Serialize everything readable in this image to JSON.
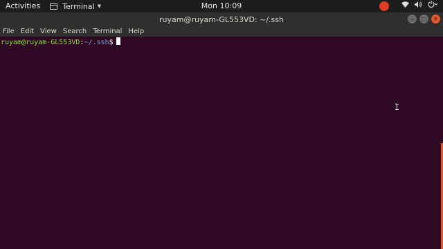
{
  "topbar": {
    "activities_label": "Activities",
    "app_name": "Terminal",
    "clock": "Mon 10:09",
    "icons": [
      "record-icon",
      "wifi-icon",
      "volume-icon",
      "power-icon"
    ]
  },
  "window": {
    "title": "ruyam@ruyam-GL553VD: ~/.ssh",
    "controls": [
      "minimize",
      "maximize",
      "close"
    ]
  },
  "menubar": {
    "items": [
      "File",
      "Edit",
      "View",
      "Search",
      "Terminal",
      "Help"
    ]
  },
  "terminal": {
    "prompt_user": "ruyam@ruyam-GL553VD",
    "prompt_sep": ":",
    "prompt_path": "~/.ssh",
    "prompt_symbol": "$"
  },
  "colors": {
    "background": "#300a24",
    "prompt_user": "#8ae234",
    "prompt_path": "#729fcf",
    "accent": "#e95420"
  }
}
